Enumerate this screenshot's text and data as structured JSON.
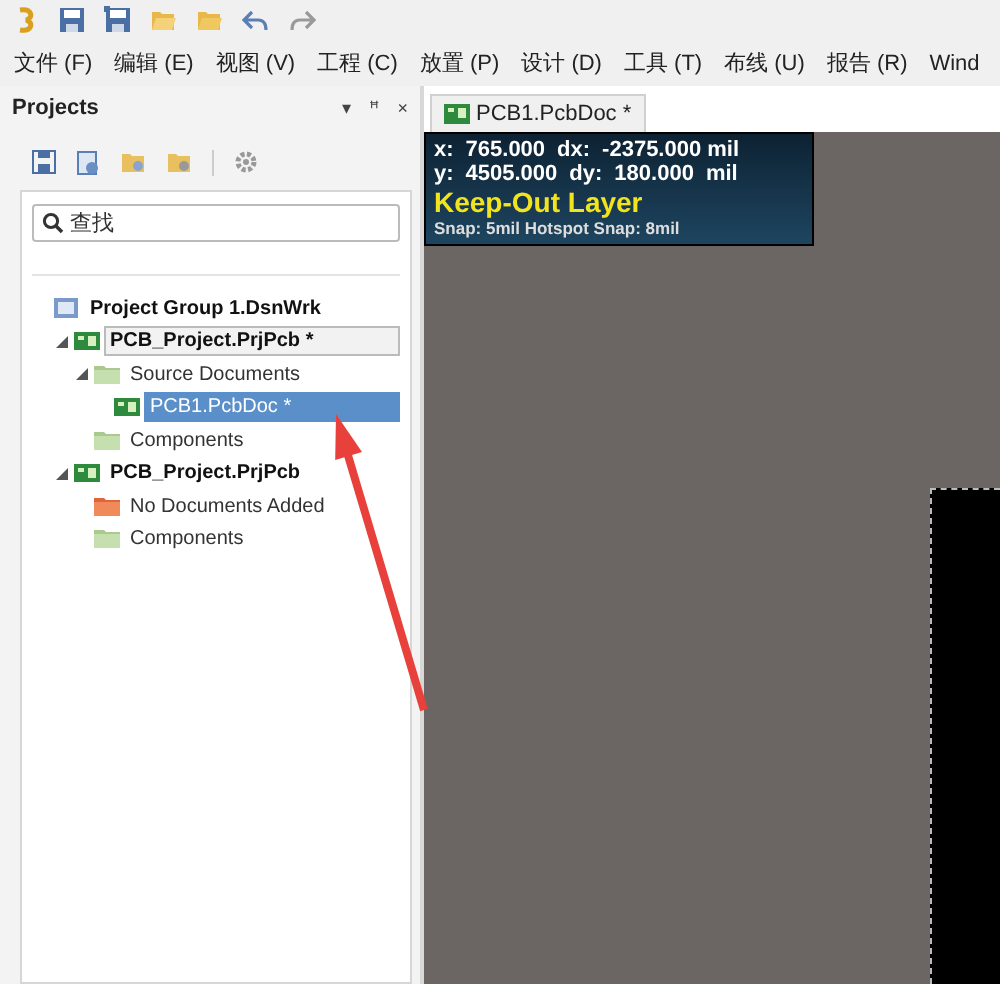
{
  "toolbar": {
    "buttons": [
      {
        "kind": "app"
      },
      {
        "kind": "save"
      },
      {
        "kind": "save-all"
      },
      {
        "kind": "open"
      },
      {
        "kind": "open-project"
      },
      {
        "kind": "undo"
      },
      {
        "kind": "redo"
      }
    ]
  },
  "menu": [
    {
      "label": "文件 (F)"
    },
    {
      "label": "编辑 (E)"
    },
    {
      "label": "视图 (V)"
    },
    {
      "label": "工程 (C)"
    },
    {
      "label": "放置 (P)"
    },
    {
      "label": "设计 (D)"
    },
    {
      "label": "工具 (T)"
    },
    {
      "label": "布线 (U)"
    },
    {
      "label": "报告 (R)"
    },
    {
      "label": "Wind"
    }
  ],
  "projects_panel": {
    "title": "Projects",
    "header_controls": [
      "▾",
      "ꟸ",
      "×"
    ],
    "search": {
      "placeholder": "查找"
    },
    "tree": [
      {
        "label": "Project Group 1.DsnWrk",
        "kind": "workspace",
        "selected": false,
        "focused": false,
        "children": [
          {
            "label": "PCB_Project.PrjPcb *",
            "kind": "project",
            "expanded": true,
            "selected": false,
            "focused": true,
            "children": [
              {
                "label": "Source Documents",
                "kind": "folder",
                "expanded": true,
                "selected": false,
                "focused": false,
                "children": [
                  {
                    "label": "PCB1.PcbDoc *",
                    "kind": "document",
                    "selected": true,
                    "focused": false
                  }
                ]
              },
              {
                "label": "Components",
                "kind": "folder",
                "selected": false,
                "focused": false
              }
            ]
          },
          {
            "label": "PCB_Project.PrjPcb",
            "kind": "project",
            "expanded": true,
            "selected": false,
            "focused": false,
            "children": [
              {
                "label": "No Documents Added",
                "kind": "empty-folder",
                "selected": false,
                "focused": false
              },
              {
                "label": "Components",
                "kind": "folder",
                "selected": false,
                "focused": false
              }
            ]
          }
        ]
      }
    ]
  },
  "document_tab": {
    "label": "PCB1.PcbDoc *",
    "selected": true
  },
  "info_overlay": {
    "rows": [
      [
        "x:",
        "765.000",
        "dx:",
        "-2375.000 mil"
      ],
      [
        "y:",
        "4505.000",
        "dy:",
        "180.000",
        "mil"
      ]
    ],
    "layer": "Keep-Out Layer",
    "snap": "Snap: 5mil Hotspot Snap: 8mil"
  }
}
